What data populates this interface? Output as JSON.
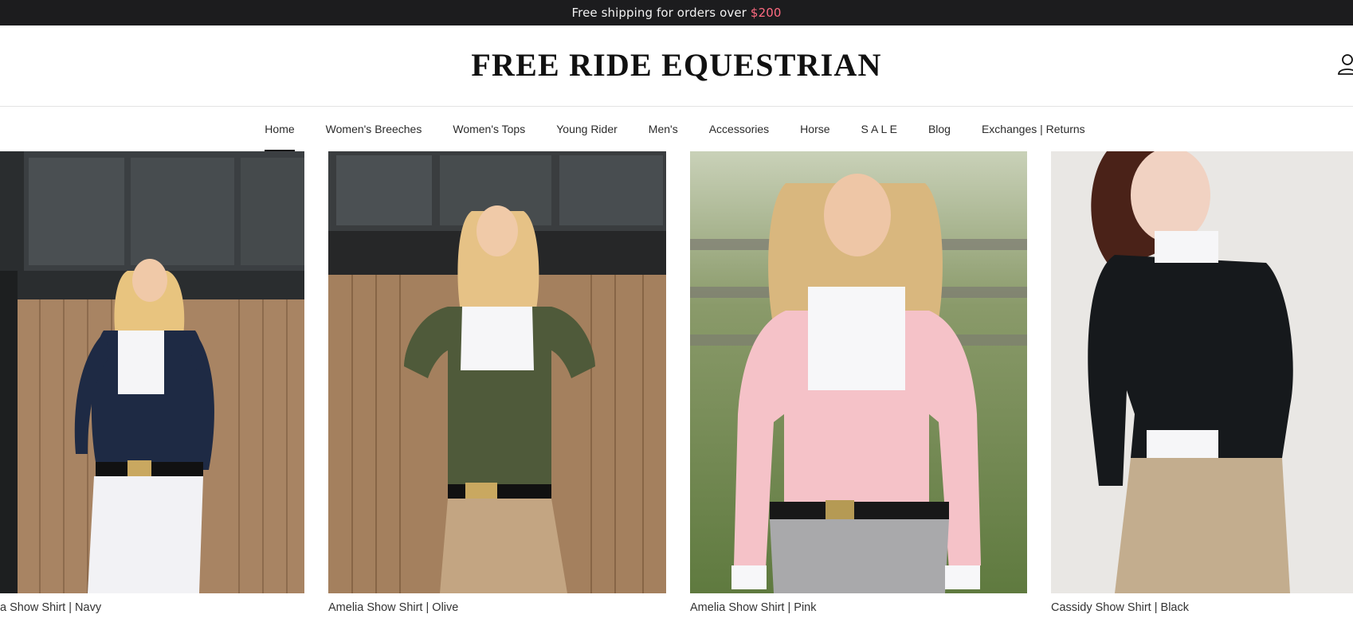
{
  "announcement": {
    "text": "Free shipping for orders over",
    "amount": "$200"
  },
  "header": {
    "logo": "FREE RIDE EQUESTRIAN",
    "account_icon": "user-icon"
  },
  "nav": {
    "items": [
      {
        "label": "Home",
        "active": true
      },
      {
        "label": "Women's Breeches"
      },
      {
        "label": "Women's Tops"
      },
      {
        "label": "Young Rider"
      },
      {
        "label": "Men's"
      },
      {
        "label": "Accessories"
      },
      {
        "label": "Horse"
      },
      {
        "label": "S A L E"
      },
      {
        "label": "Blog"
      },
      {
        "label": "Exchanges | Returns"
      }
    ]
  },
  "products": [
    {
      "title": "a Show Shirt | Navy"
    },
    {
      "title": "Amelia Show Shirt | Olive"
    },
    {
      "title": "Amelia Show Shirt | Pink"
    },
    {
      "title": "Cassidy Show Shirt | Black"
    }
  ],
  "colors": {
    "announcement_bg": "#1c1c1e",
    "accent": "#ff6b81",
    "nav_text": "#2b2b2b"
  }
}
